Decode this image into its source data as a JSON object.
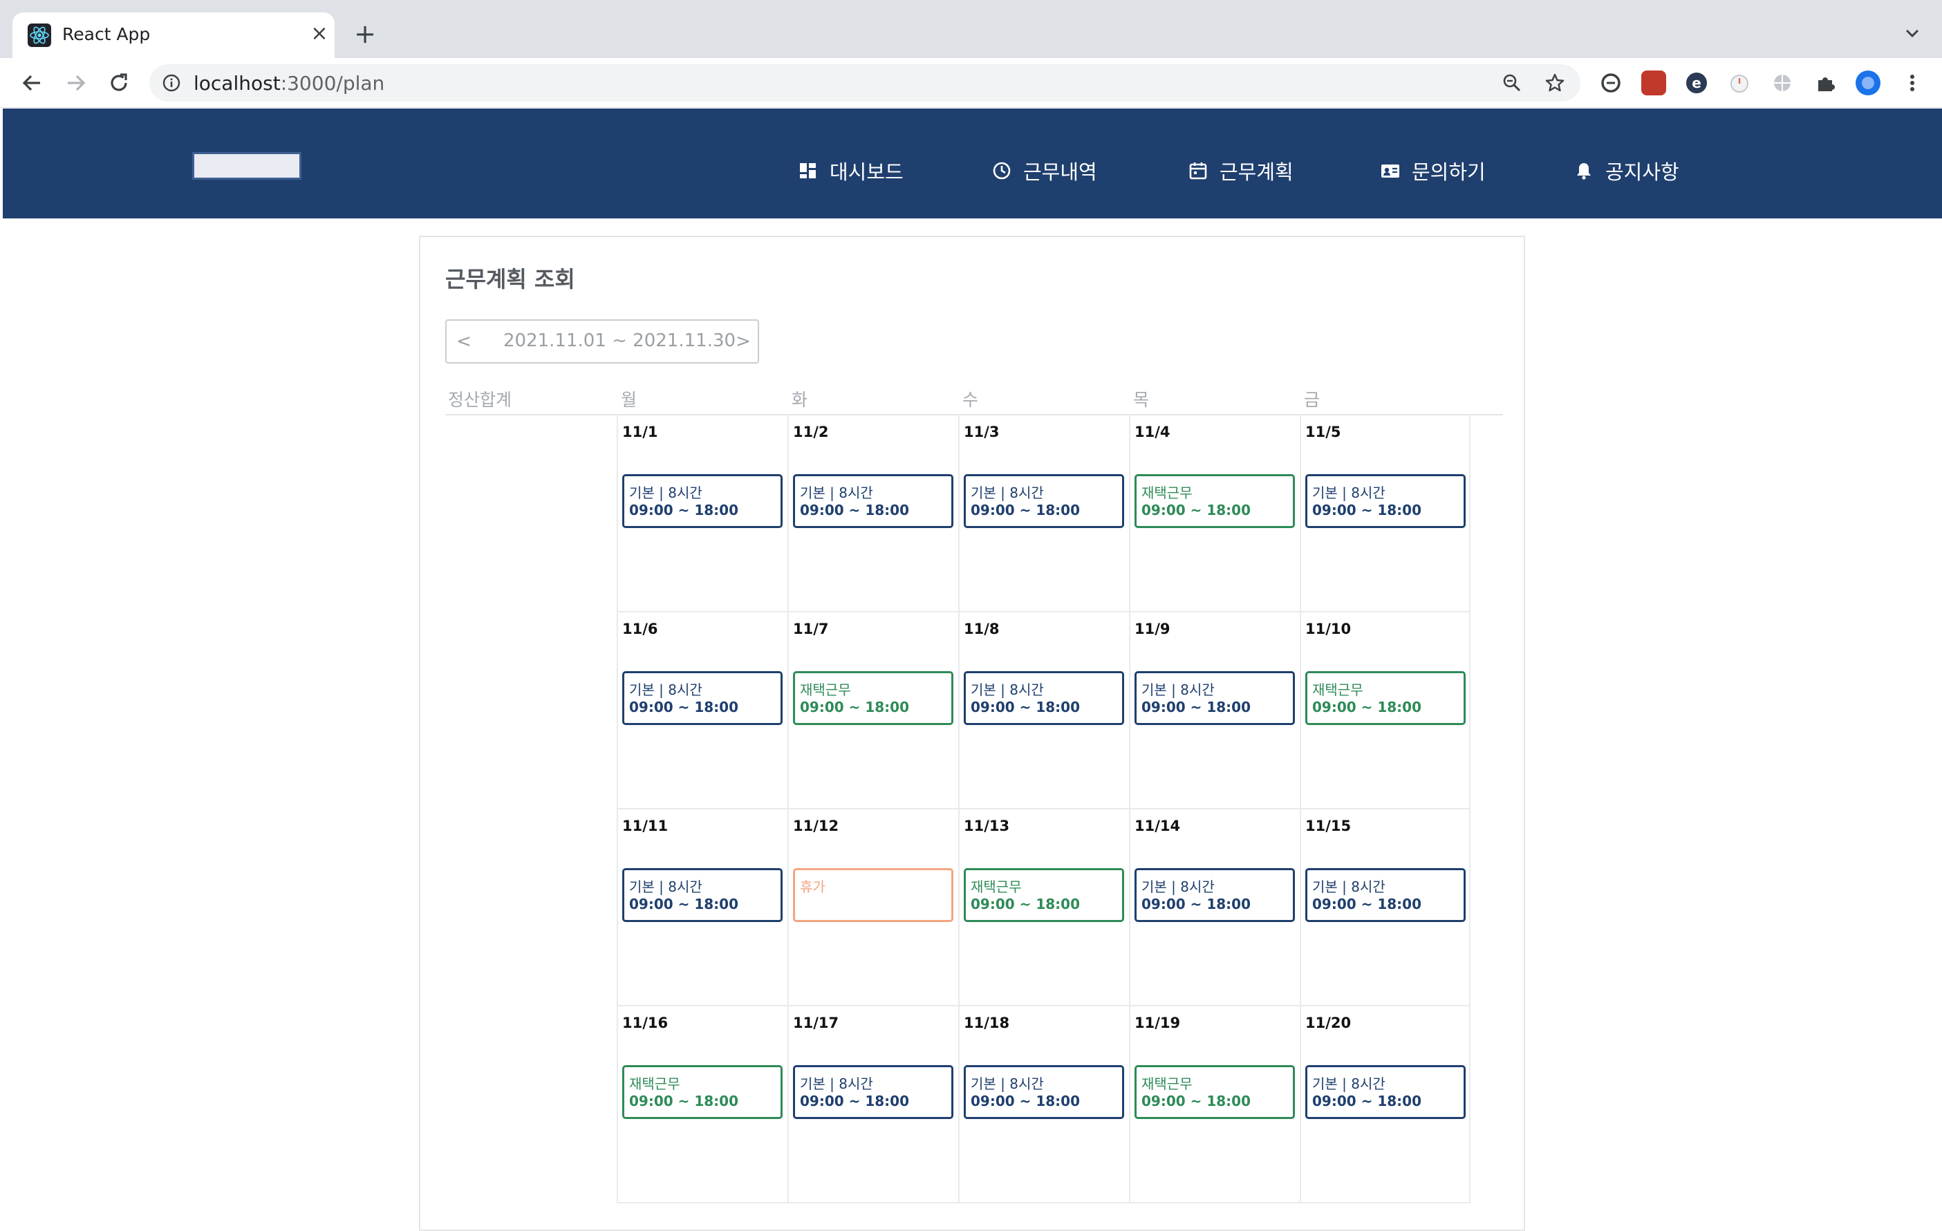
{
  "browser": {
    "tab_title": "React App",
    "url_host": "localhost",
    "url_path": ":3000/plan"
  },
  "colors": {
    "header_bg": "#1f3f6e",
    "basic": "#1f3f6e",
    "remote": "#2e8b57",
    "vacation": "#f4a582"
  },
  "nav": [
    {
      "label": "대시보드",
      "icon": "dashboard-icon"
    },
    {
      "label": "근무내역",
      "icon": "clock-icon"
    },
    {
      "label": "근무계획",
      "icon": "calendar-icon"
    },
    {
      "label": "문의하기",
      "icon": "contact-card-icon"
    },
    {
      "label": "공지사항",
      "icon": "bell-icon"
    }
  ],
  "page": {
    "title": "근무계획 조회",
    "period": {
      "prev": "<",
      "text": "2021.11.01 ~ 2021.11.30",
      "next": ">"
    },
    "columns": [
      "정산합계",
      "월",
      "화",
      "수",
      "목",
      "금"
    ]
  },
  "weeks": [
    [
      {
        "date": "11/1",
        "type": "basic",
        "label": "기본 | 8시간",
        "time": "09:00 ~ 18:00"
      },
      {
        "date": "11/2",
        "type": "basic",
        "label": "기본 | 8시간",
        "time": "09:00 ~ 18:00"
      },
      {
        "date": "11/3",
        "type": "basic",
        "label": "기본 | 8시간",
        "time": "09:00 ~ 18:00"
      },
      {
        "date": "11/4",
        "type": "remote",
        "label": "재택근무",
        "time": "09:00 ~ 18:00"
      },
      {
        "date": "11/5",
        "type": "basic",
        "label": "기본 | 8시간",
        "time": "09:00 ~ 18:00"
      }
    ],
    [
      {
        "date": "11/6",
        "type": "basic",
        "label": "기본 | 8시간",
        "time": "09:00 ~ 18:00"
      },
      {
        "date": "11/7",
        "type": "remote",
        "label": "재택근무",
        "time": "09:00 ~ 18:00"
      },
      {
        "date": "11/8",
        "type": "basic",
        "label": "기본 | 8시간",
        "time": "09:00 ~ 18:00"
      },
      {
        "date": "11/9",
        "type": "basic",
        "label": "기본 | 8시간",
        "time": "09:00 ~ 18:00"
      },
      {
        "date": "11/10",
        "type": "remote",
        "label": "재택근무",
        "time": "09:00 ~ 18:00"
      }
    ],
    [
      {
        "date": "11/11",
        "type": "basic",
        "label": "기본 | 8시간",
        "time": "09:00 ~ 18:00"
      },
      {
        "date": "11/12",
        "type": "vacation",
        "label": "휴가",
        "time": ""
      },
      {
        "date": "11/13",
        "type": "remote",
        "label": "재택근무",
        "time": "09:00 ~ 18:00"
      },
      {
        "date": "11/14",
        "type": "basic",
        "label": "기본 | 8시간",
        "time": "09:00 ~ 18:00"
      },
      {
        "date": "11/15",
        "type": "basic",
        "label": "기본 | 8시간",
        "time": "09:00 ~ 18:00"
      }
    ],
    [
      {
        "date": "11/16",
        "type": "remote",
        "label": "재택근무",
        "time": "09:00 ~ 18:00"
      },
      {
        "date": "11/17",
        "type": "basic",
        "label": "기본 | 8시간",
        "time": "09:00 ~ 18:00"
      },
      {
        "date": "11/18",
        "type": "basic",
        "label": "기본 | 8시간",
        "time": "09:00 ~ 18:00"
      },
      {
        "date": "11/19",
        "type": "remote",
        "label": "재택근무",
        "time": "09:00 ~ 18:00"
      },
      {
        "date": "11/20",
        "type": "basic",
        "label": "기본 | 8시간",
        "time": "09:00 ~ 18:00"
      }
    ]
  ]
}
